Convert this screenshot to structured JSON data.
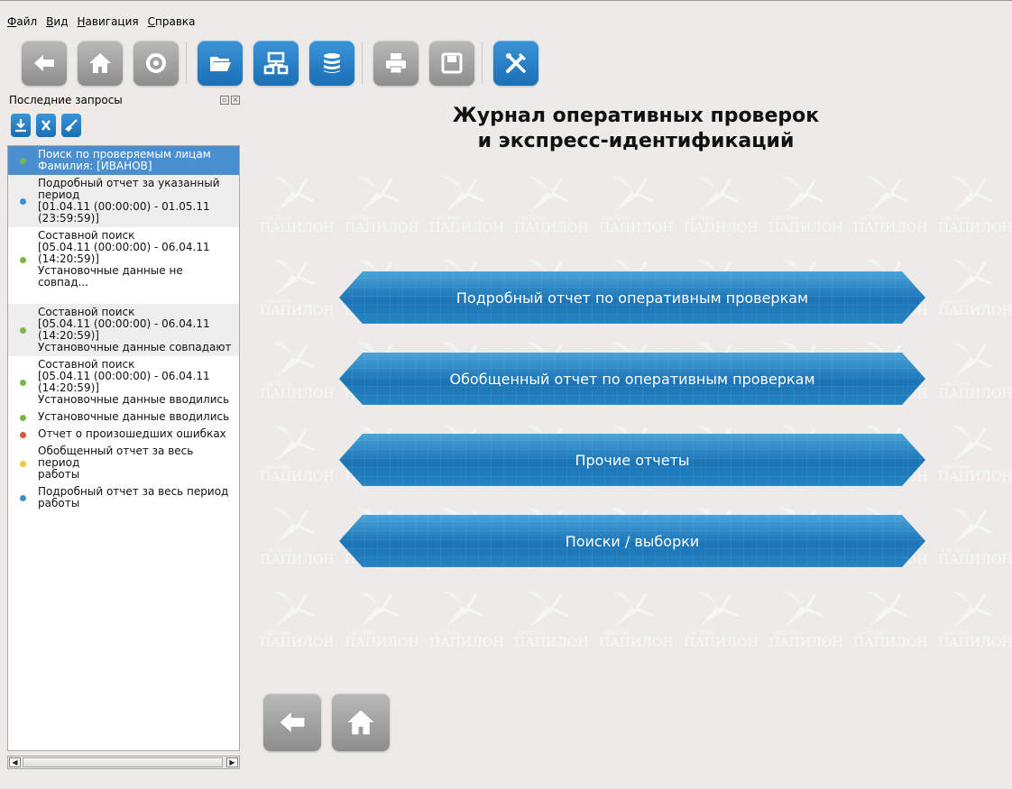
{
  "menubar": {
    "items": [
      "Файл",
      "Вид",
      "Навигация",
      "Справка"
    ]
  },
  "toolbar": {
    "buttons": [
      {
        "icon": "back-arrow-icon"
      },
      {
        "icon": "home-icon"
      },
      {
        "icon": "refresh-icon"
      },
      {
        "icon": "folder-open-icon"
      },
      {
        "icon": "network-icon"
      },
      {
        "icon": "database-icon"
      },
      {
        "icon": "printer-icon"
      },
      {
        "icon": "save-icon"
      },
      {
        "icon": "tools-icon"
      }
    ]
  },
  "sidebar": {
    "title": "Последние запросы",
    "tools": [
      {
        "icon": "download-icon"
      },
      {
        "icon": "delete-icon"
      },
      {
        "icon": "clear-brush-icon"
      }
    ],
    "items": [
      {
        "lines": [
          "Поиск по проверяемым лицам",
          "Фамилия: [ИВАНОВ]"
        ],
        "color": "#7ab648",
        "selected": true
      },
      {
        "lines": [
          "Подробный отчет за указанный",
          "период",
          "[01.04.11 (00:00:00) - 01.05.11",
          "(23:59:59)]"
        ],
        "color": "#3a8fd3"
      },
      {
        "lines": [
          "Составной поиск",
          "[05.04.11 (00:00:00) - 06.04.11",
          "(14:20:59)]",
          "Установочные данные не совпад..."
        ],
        "color": "#7ab648"
      },
      {
        "lines": [
          "Составной поиск",
          "[05.04.11 (00:00:00) - 06.04.11",
          "(14:20:59)]",
          "Установочные данные совпадают"
        ],
        "color": "#7ab648"
      },
      {
        "lines": [
          "Составной поиск",
          "[05.04.11 (00:00:00) - 06.04.11",
          "(14:20:59)]",
          "Установочные данные вводились"
        ],
        "color": "#7ab648"
      },
      {
        "lines": [
          "Установочные данные вводились"
        ],
        "color": "#7ab648"
      },
      {
        "lines": [
          "Отчет о произошедших ошибках"
        ],
        "color": "#e0533c"
      },
      {
        "lines": [
          "Обобщенный отчет за весь период",
          "работы"
        ],
        "color": "#f2c84b"
      },
      {
        "lines": [
          "Подробный отчет за весь период",
          "работы"
        ],
        "color": "#3a8fd3"
      }
    ]
  },
  "main": {
    "title_line1": "Журнал оперативных проверок",
    "title_line2": "и экспресс-идентификаций",
    "watermark_small": "СИСТЕМЫ",
    "watermark_big": "ПАПИЛОН",
    "buttons": [
      "Подробный отчет по оперативным проверкам",
      "Обобщенный отчет по оперативным проверкам",
      "Прочие отчеты",
      "Поиски / выборки"
    ]
  },
  "colors": {
    "accent_blue": "#1b6fb5",
    "button_gray": "#8d8d8d",
    "selection": "#4a90d0"
  }
}
